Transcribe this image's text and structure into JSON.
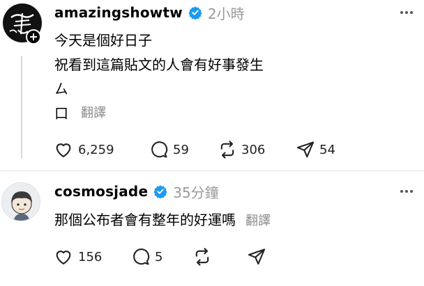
{
  "post1": {
    "username": "amazingshowtw",
    "timestamp": "2小時",
    "avatar_glyph": "義春",
    "body_lines": [
      "今天是個好日子",
      "祝看到這篇貼文的人會有好事發生",
      "ㄙ",
      "口"
    ],
    "translate_label": "翻譯",
    "counts": {
      "likes": "6,259",
      "comments": "59",
      "reposts": "306",
      "shares": "54"
    }
  },
  "post2": {
    "username": "cosmosjade",
    "timestamp": "35分鐘",
    "body": "那個公布者會有整年的好運嗎",
    "translate_label": "翻譯",
    "counts": {
      "likes": "156",
      "comments": "5"
    }
  },
  "colors": {
    "verified": "#1d9bf0",
    "muted": "#999999",
    "thread_line": "#d9d9d9"
  }
}
